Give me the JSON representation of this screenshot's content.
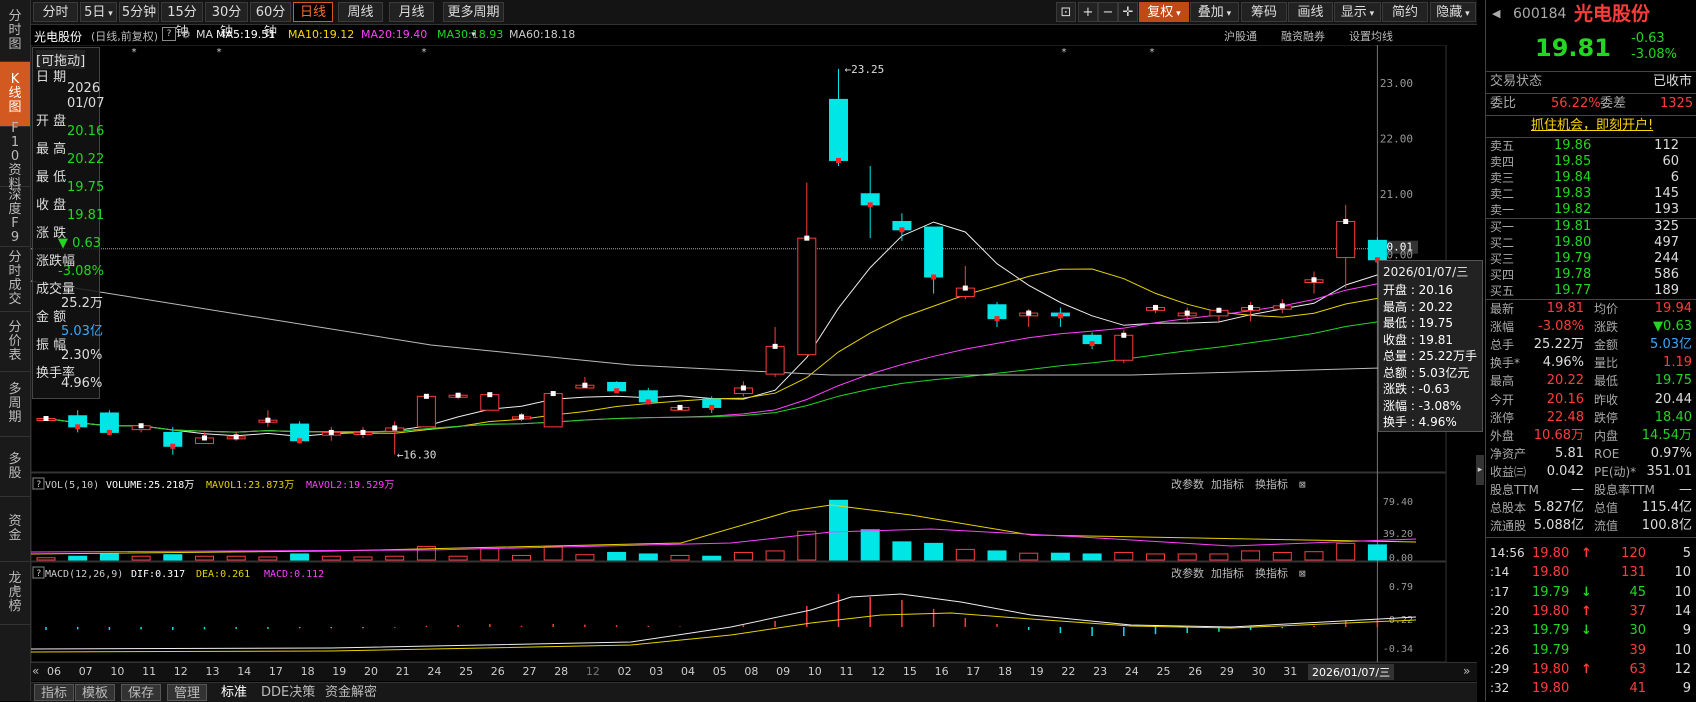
{
  "sidebar": {
    "items": [
      {
        "label": "分时图"
      },
      {
        "label": "K线图"
      },
      {
        "label": "F10资料"
      },
      {
        "label": "深度F9"
      },
      {
        "label": "分时成交"
      },
      {
        "label": "分价表"
      },
      {
        "label": "多周期"
      },
      {
        "label": "多股"
      },
      {
        "label": "资金"
      },
      {
        "label": "龙虎榜"
      }
    ]
  },
  "toolbar": {
    "periods": [
      "分时",
      "5日",
      "5分钟",
      "15分钟",
      "30分钟",
      "60分钟",
      "日线",
      "周线",
      "月线",
      "更多周期"
    ],
    "active_period": "日线",
    "right": [
      "复权",
      "叠加",
      "筹码",
      "画线",
      "显示",
      "简约",
      "隐藏"
    ]
  },
  "chart_header": {
    "stock": "光电股份",
    "mode": "(日线,前复权)",
    "ma_label": "MA",
    "ma5": "MA5:19.51",
    "ma10": "MA10:19.12",
    "ma20": "MA20:19.40",
    "ma30": "MA30:18.93",
    "ma60": "MA60:18.18",
    "links": [
      "沪股通",
      "融资融券",
      "设置均线"
    ]
  },
  "left_info": {
    "draggable": "[可拖动]",
    "date_label": "日  期",
    "year": "2026",
    "date": "01/07",
    "open_label": "开  盘",
    "open": "20.16",
    "high_label": "最  高",
    "high": "20.22",
    "low_label": "最  低",
    "low": "19.75",
    "close_label": "收  盘",
    "close": "19.81",
    "chg_label": "涨  跌",
    "chg": "▼ 0.63",
    "pct_label": "涨跌幅",
    "pct": "-3.08%",
    "vol_label": "成交量",
    "vol": "25.2万",
    "amt_label": "金  额",
    "amt": "5.03亿",
    "amp_label": "振  幅",
    "amp": "2.30%",
    "turn_label": "换手率",
    "turn": "4.96%"
  },
  "tooltip": {
    "date": "2026/01/07/三",
    "rows": [
      "开盘 : 20.16",
      "最高 : 20.22",
      "最低 : 19.75",
      "收盘 : 19.81",
      "总量 : 25.22万手",
      "总额 : 5.03亿元",
      "涨跌 : -0.63",
      "涨幅 : -3.08%",
      "换手 : 4.96%"
    ]
  },
  "annotations": {
    "max": "23.25",
    "min": "16.30"
  },
  "vol_header": {
    "title": "VOL(5,10)",
    "volume": "VOLUME:25.218万",
    "mavol1": "MAVOL1:23.873万",
    "mavol2": "MAVOL2:19.529万"
  },
  "macd_header": {
    "title": "MACD(12,26,9)",
    "dif": "DIF:0.317",
    "dea": "DEA:0.261",
    "macd": "MACD:0.112"
  },
  "panel_links": [
    "改参数",
    "加指标",
    "换指标"
  ],
  "price_axis": [
    "23.00",
    "22.00",
    "21.00",
    "20.01",
    "20.00"
  ],
  "vol_axis": [
    "79.40",
    "39.20",
    "0.00"
  ],
  "macd_axis": [
    "0.79",
    "0.22",
    "-0.34"
  ],
  "date_axis": [
    "06",
    "07",
    "10",
    "11",
    "12",
    "13",
    "14",
    "17",
    "18",
    "19",
    "20",
    "21",
    "24",
    "25",
    "26",
    "27",
    "28",
    "12",
    "02",
    "03",
    "04",
    "05",
    "08",
    "09",
    "10",
    "11",
    "12",
    "15",
    "16",
    "17",
    "18",
    "19",
    "22",
    "23",
    "24",
    "25",
    "26",
    "29",
    "30",
    "31"
  ],
  "date_axis_current": "2026/01/07/三",
  "bottom_tabs": [
    "指标",
    "模板",
    "保存",
    "管理",
    "标准",
    "DDE决策",
    "资金解密"
  ],
  "chart_data": {
    "type": "candlestick",
    "title": "光电股份",
    "ylim": [
      16.0,
      23.5
    ],
    "candles": [
      [
        16.95,
        16.95,
        16.85,
        16.85
      ],
      [
        17.0,
        16.8,
        17.1,
        16.7
      ],
      [
        17.05,
        16.7,
        17.1,
        16.65
      ],
      [
        16.75,
        16.82,
        16.85,
        16.7
      ],
      [
        16.7,
        16.45,
        16.8,
        16.3
      ],
      [
        16.5,
        16.6,
        16.7,
        16.5
      ],
      [
        16.6,
        16.62,
        16.72,
        16.55
      ],
      [
        16.9,
        16.92,
        17.1,
        16.8
      ],
      [
        16.85,
        16.55,
        16.9,
        16.5
      ],
      [
        16.65,
        16.7,
        16.8,
        16.55
      ],
      [
        16.68,
        16.7,
        16.8,
        16.6
      ],
      [
        16.72,
        16.78,
        16.9,
        16.3
      ],
      [
        16.8,
        17.35,
        17.35,
        16.8
      ],
      [
        17.35,
        17.37,
        17.4,
        17.3
      ],
      [
        17.1,
        17.38,
        17.4,
        17.1
      ],
      [
        16.95,
        16.98,
        17.05,
        16.9
      ],
      [
        16.8,
        17.4,
        17.4,
        16.8
      ],
      [
        17.5,
        17.55,
        17.7,
        17.5
      ],
      [
        17.6,
        17.45,
        17.62,
        17.45
      ],
      [
        17.45,
        17.25,
        17.5,
        17.2
      ],
      [
        17.1,
        17.15,
        17.18,
        17.1
      ],
      [
        17.3,
        17.15,
        17.35,
        17.05
      ],
      [
        17.4,
        17.5,
        17.62,
        17.35
      ],
      [
        17.75,
        18.25,
        18.6,
        17.7
      ],
      [
        18.1,
        20.2,
        21.2,
        18.1
      ],
      [
        22.7,
        21.6,
        23.25,
        21.5
      ],
      [
        21.0,
        20.8,
        21.5,
        20.2
      ],
      [
        20.5,
        20.35,
        20.65,
        20.15
      ],
      [
        20.4,
        19.5,
        20.4,
        19.2
      ],
      [
        19.15,
        19.3,
        19.7,
        19.1
      ],
      [
        19.0,
        18.75,
        19.05,
        18.6
      ],
      [
        18.8,
        18.85,
        18.92,
        18.6
      ],
      [
        18.85,
        18.8,
        18.95,
        18.6
      ],
      [
        18.45,
        18.3,
        18.5,
        18.2
      ],
      [
        18.0,
        18.45,
        18.55,
        17.95
      ],
      [
        18.9,
        18.95,
        19.0,
        18.85
      ],
      [
        18.8,
        18.85,
        18.95,
        18.7
      ],
      [
        18.8,
        18.9,
        18.95,
        18.7
      ],
      [
        18.9,
        18.95,
        19.05,
        18.7
      ],
      [
        18.92,
        18.98,
        19.1,
        18.85
      ],
      [
        19.4,
        19.45,
        19.6,
        19.2
      ],
      [
        19.85,
        20.5,
        20.8,
        19.3
      ],
      [
        20.16,
        19.81,
        20.22,
        19.75
      ]
    ],
    "volumes": [
      3,
      5,
      8,
      5,
      7,
      5,
      5,
      4,
      8,
      5,
      4,
      5,
      18,
      5,
      15,
      6,
      18,
      7,
      10,
      8,
      6,
      5,
      10,
      12,
      38,
      79,
      40,
      24,
      22,
      14,
      12,
      9,
      9,
      8,
      10,
      8,
      8,
      8,
      12,
      10,
      11,
      22,
      20
    ],
    "macd_hist": [
      -0.05,
      -0.04,
      -0.05,
      -0.04,
      -0.05,
      -0.04,
      -0.03,
      -0.03,
      -0.02,
      -0.02,
      -0.02,
      -0.01,
      0.02,
      0.03,
      0.05,
      0.02,
      0.05,
      0.04,
      0.03,
      0.02,
      0.01,
      0.0,
      0.03,
      0.1,
      0.35,
      0.55,
      0.5,
      0.45,
      0.3,
      0.15,
      0.05,
      -0.05,
      -0.1,
      -0.15,
      -0.15,
      -0.12,
      -0.1,
      -0.08,
      -0.05,
      -0.02,
      0.02,
      0.1,
      0.11
    ]
  },
  "right_panel": {
    "code": "600184",
    "name": "光电股份",
    "price": "19.81",
    "chg": "-0.63",
    "pct": "-3.08%",
    "status_label": "交易状态",
    "status": "已收市",
    "weibi_label": "委比",
    "weibi": "56.22%",
    "weicha_label": "委差",
    "weicha": "1325",
    "promo": "抓住机会，即刻开户!",
    "asks": [
      [
        "卖五",
        "19.86",
        "112"
      ],
      [
        "卖四",
        "19.85",
        "60"
      ],
      [
        "卖三",
        "19.84",
        "6"
      ],
      [
        "卖二",
        "19.83",
        "145"
      ],
      [
        "卖一",
        "19.82",
        "193"
      ]
    ],
    "bids": [
      [
        "买一",
        "19.81",
        "325"
      ],
      [
        "买二",
        "19.80",
        "497"
      ],
      [
        "买三",
        "19.79",
        "244"
      ],
      [
        "买四",
        "19.78",
        "586"
      ],
      [
        "买五",
        "19.77",
        "189"
      ]
    ],
    "stats": [
      [
        "最新",
        "19.81",
        "red",
        "均价",
        "19.94",
        "red"
      ],
      [
        "涨幅",
        "-3.08%",
        "red",
        "涨跌",
        "▼0.63",
        "green"
      ],
      [
        "总手",
        "25.22万",
        "white",
        "金额",
        "5.03亿",
        "blue"
      ],
      [
        "换手*",
        "4.96%",
        "white",
        "量比",
        "1.19",
        "red"
      ],
      [
        "最高",
        "20.22",
        "red",
        "最低",
        "19.75",
        "green"
      ],
      [
        "今开",
        "20.16",
        "red",
        "昨收",
        "20.44",
        "white"
      ],
      [
        "涨停",
        "22.48",
        "red",
        "跌停",
        "18.40",
        "green"
      ],
      [
        "外盘",
        "10.68万",
        "red",
        "内盘",
        "14.54万",
        "green"
      ],
      [
        "净资产",
        "5.81",
        "white",
        "ROE",
        "0.97%",
        "white"
      ],
      [
        "收益㈢",
        "0.042",
        "white",
        "PE(动)*",
        "351.01",
        "white"
      ],
      [
        "股息TTM",
        "—",
        "white",
        "股息率TTM",
        "—",
        "white"
      ],
      [
        "总股本",
        "5.827亿",
        "white",
        "总值",
        "115.4亿",
        "white"
      ],
      [
        "流通股",
        "5.088亿",
        "white",
        "流值",
        "100.8亿",
        "white"
      ]
    ],
    "ticks": [
      [
        "14:56",
        "19.80",
        "↑",
        "120",
        "5"
      ],
      [
        ":14",
        "19.80",
        "",
        "131",
        "10"
      ],
      [
        ":17",
        "19.79",
        "↓",
        "45",
        "10"
      ],
      [
        ":20",
        "19.80",
        "↑",
        "37",
        "14"
      ],
      [
        ":23",
        "19.79",
        "↓",
        "30",
        "9"
      ],
      [
        ":26",
        "19.79",
        "",
        "39",
        "10"
      ],
      [
        ":29",
        "19.80",
        "↑",
        "63",
        "12"
      ],
      [
        ":32",
        "19.80",
        "",
        "41",
        "9"
      ]
    ]
  }
}
